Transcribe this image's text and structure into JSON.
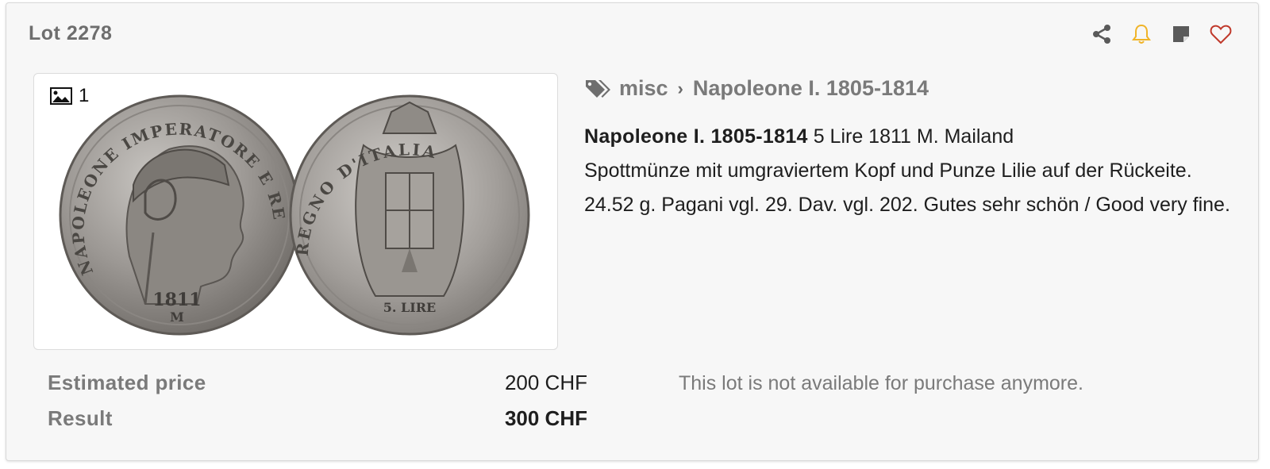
{
  "lot": {
    "title": "Lot 2278"
  },
  "actions": [
    {
      "name": "share-icon",
      "color": "#5a5a5a"
    },
    {
      "name": "bell-icon",
      "color": "#f0b429"
    },
    {
      "name": "note-icon",
      "color": "#5a5a5a"
    },
    {
      "name": "heart-icon",
      "color": "#c0392b"
    }
  ],
  "gallery": {
    "count": "1",
    "icon": "image-icon"
  },
  "breadcrumb": {
    "icon": "tags-icon",
    "category": "misc",
    "separator": "›",
    "subcategory": "Napoleone I. 1805-1814"
  },
  "description": {
    "heading": "Napoleone I. 1805-1814",
    "line1": "5 Lire 1811 M. Mailand",
    "line2": "Spottmünze mit umgraviertem Kopf und Punze Lilie auf der Rückeite.",
    "line3": "24.52 g. Pagani vgl. 29. Dav. vgl. 202. Gutes sehr schön / Good very fine."
  },
  "coin_text": {
    "obverse_legend": "NAPOLEONE IMPERATORE E RE",
    "obverse_year": "1811",
    "obverse_mint": "M",
    "reverse_legend": "REGNO D'ITALIA",
    "reverse_value": "5. LIRE"
  },
  "pricing": {
    "estimated_label": "Estimated price",
    "estimated_value": "200 CHF",
    "result_label": "Result",
    "result_value": "300 CHF"
  },
  "status": {
    "message": "This lot is not available for purchase anymore."
  }
}
